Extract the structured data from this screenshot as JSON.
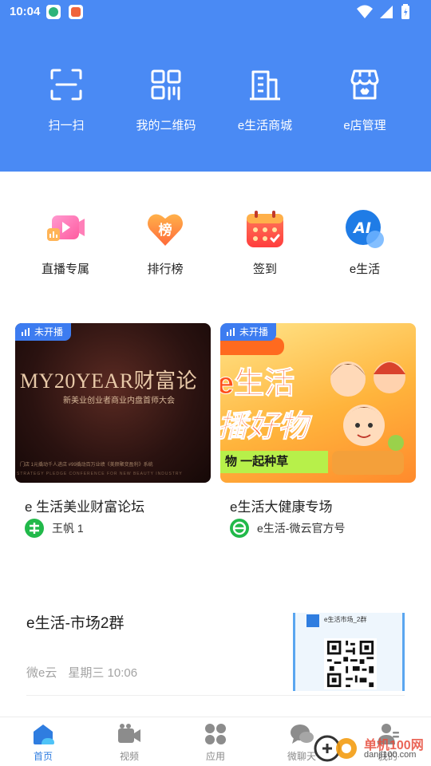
{
  "status_bar": {
    "time": "10:04"
  },
  "quick_actions": [
    {
      "label": "扫一扫",
      "icon": "scan-icon"
    },
    {
      "label": "我的二维码",
      "icon": "qrcode-icon"
    },
    {
      "label": "e生活商城",
      "icon": "mall-building-icon"
    },
    {
      "label": "e店管理",
      "icon": "shop-manage-icon"
    }
  ],
  "apps": [
    {
      "label": "直播专属",
      "icon": "live-video-icon"
    },
    {
      "label": "排行榜",
      "icon": "ranking-heart-icon",
      "glyph": "榜"
    },
    {
      "label": "签到",
      "icon": "calendar-checkin-icon"
    },
    {
      "label": "e生活",
      "icon": "ai-icon",
      "glyph": "AI"
    }
  ],
  "live_cards": [
    {
      "badge": "未开播",
      "title": "e 生活美业财富论坛",
      "author": "王帆 1",
      "poster": {
        "main": "MY20YEAR财富论",
        "sub": "新美业创业者商业内盘首师大会",
        "fine": "门店 1元撬动千人进店 #99撬动百万业绩《美颜聚变盈利》系统",
        "fine2": "STRATEGY PLEDGE CONFERENCE FOR NEW BEAUTY INDUSTRY"
      }
    },
    {
      "badge": "未开播",
      "title": "e生活大健康专场",
      "author": "e生活-微云官方号",
      "poster": {
        "line1": "e生活",
        "line2": "播好物",
        "slogan": "物 一起种草"
      }
    }
  ],
  "group_chat": {
    "title": "e生活-市场2群",
    "source": "微e云",
    "time": "星期三 10:06",
    "thumb_name": "e生活市场_2群"
  },
  "tabs": [
    {
      "label": "首页",
      "icon": "home-icon",
      "active": true
    },
    {
      "label": "视频",
      "icon": "video-camera-icon",
      "active": false
    },
    {
      "label": "应用",
      "icon": "apps-grid-icon",
      "active": false
    },
    {
      "label": "微聊天",
      "icon": "chat-bubble-icon",
      "active": false
    },
    {
      "label": "我的",
      "icon": "profile-icon",
      "active": false
    }
  ],
  "watermark": {
    "text": "单机100网",
    "url": "danji100.com"
  },
  "colors": {
    "header": "#4a8af4",
    "accent": "#2f7de0",
    "badge": "#3d7cf0",
    "author_green": "#21b94a"
  }
}
